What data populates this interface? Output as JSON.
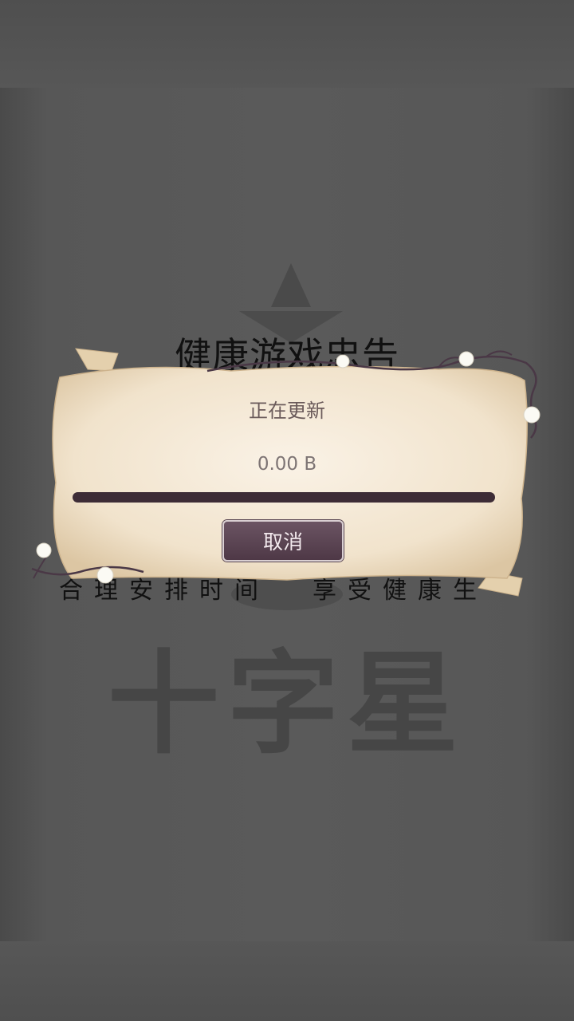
{
  "notice": {
    "title": "健康游戏忠告",
    "line_left": "合理安排时间",
    "line_right": "享受健康生"
  },
  "brand": {
    "name": "十字星"
  },
  "dialog": {
    "status": "正在更新",
    "size": "0.00 B",
    "progress": 0,
    "cancel_label": "取消"
  },
  "colors": {
    "background": "#555555",
    "parchment": "#f3e6d0",
    "progress_track": "#3d2c36",
    "button": "#5a4452"
  }
}
